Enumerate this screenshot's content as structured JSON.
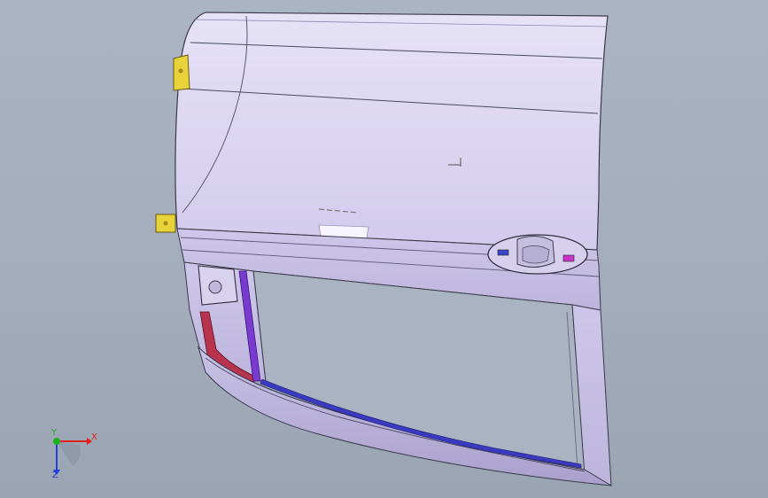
{
  "viewport": {
    "background_top": "#aab4c2",
    "background_bottom": "#9aa4b2"
  },
  "model": {
    "part": "door-assembly",
    "panel_color": "#dcd6f2",
    "edge_color": "#3a3a4a",
    "hinge_color": "#e8d43a",
    "seal_color": "#5a2ea8",
    "inner_seal_color": "#b02a4a",
    "handle_color": "#c8c8d8"
  },
  "triad": {
    "x_label": "X",
    "y_label": "Y",
    "z_label": "Z",
    "x_color": "#e02020",
    "y_color": "#20b020",
    "z_color": "#2040e0"
  }
}
